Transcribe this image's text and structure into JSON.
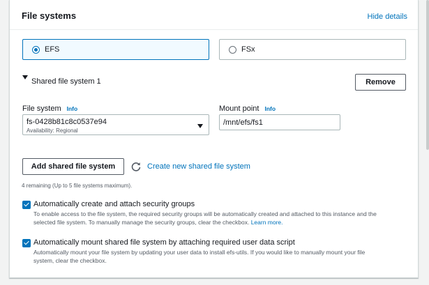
{
  "section": {
    "title": "File systems",
    "hide_details": "Hide details"
  },
  "fs_type": {
    "options": [
      {
        "label": "EFS",
        "selected": true
      },
      {
        "label": "FSx",
        "selected": false
      }
    ]
  },
  "shared_fs": {
    "heading": "Shared file system 1",
    "remove_label": "Remove",
    "file_system_label": "File system",
    "file_system_info": "Info",
    "file_system_value": "fs-0428b81c8c0537e94",
    "file_system_availability": "Availability: Regional",
    "mount_point_label": "Mount point",
    "mount_point_info": "Info",
    "mount_point_value": "/mnt/efs/fs1"
  },
  "actions": {
    "add_label": "Add shared file system",
    "create_label": "Create new shared file system",
    "remaining_text": "4 remaining (Up to 5 file systems maximum)."
  },
  "checkboxes": {
    "security": {
      "checked": true,
      "title": "Automatically create and attach security groups",
      "desc_line1": "To enable access to the file system, the required security groups will be automatically created and attached to this instance and the",
      "desc_line2": "selected file system. To manually manage the security groups, clear the checkbox.",
      "learn_more": "Learn more."
    },
    "mount": {
      "checked": true,
      "title": "Automatically mount shared file system by attaching required user data script",
      "desc_line1": "Automatically mount your file system by updating your user data to install efs-utils. If you would like to manually mount your file",
      "desc_line2": "system, clear the checkbox."
    }
  },
  "colors": {
    "accent": "#0073bb",
    "background": "#f2f3f3",
    "selected_tile_bg": "#f1faff"
  }
}
